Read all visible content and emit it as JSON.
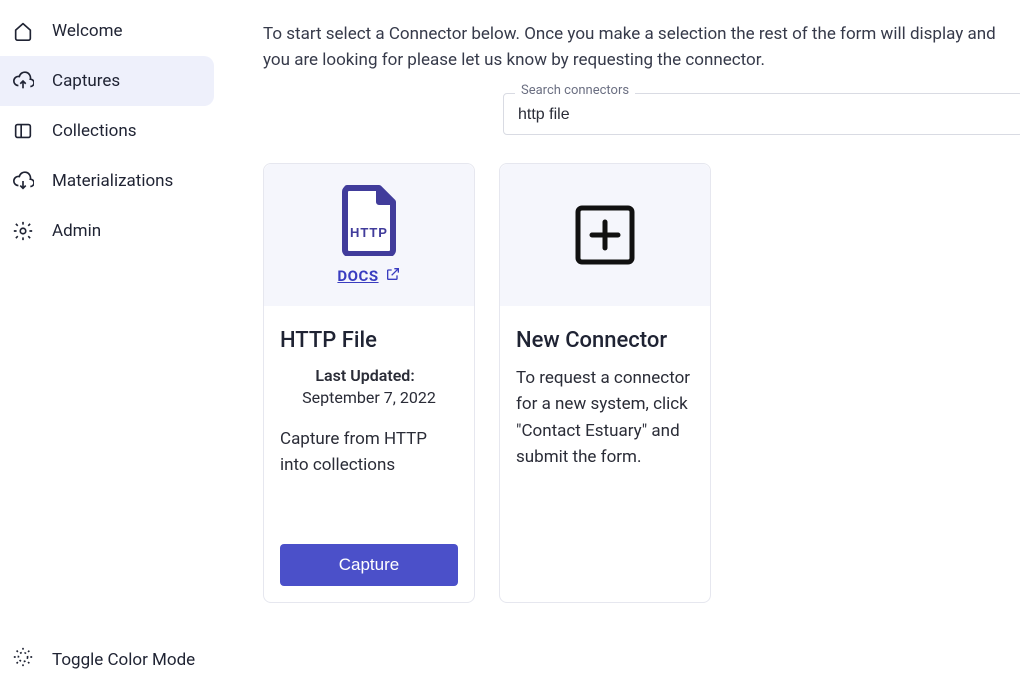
{
  "sidebar": {
    "items": [
      {
        "label": "Welcome"
      },
      {
        "label": "Captures"
      },
      {
        "label": "Collections"
      },
      {
        "label": "Materializations"
      },
      {
        "label": "Admin"
      }
    ],
    "toggle_color_mode": "Toggle Color Mode"
  },
  "intro": "To start select a Connector below. Once you make a selection the rest of the form will display and you are looking for please let us know by requesting the connector.",
  "search": {
    "label": "Search connectors",
    "value": "http file"
  },
  "connector_card": {
    "docs_label": "DOCS",
    "title": "HTTP File",
    "last_updated_label": "Last Updated:",
    "last_updated_value": "September 7, 2022",
    "description": "Capture from HTTP into collections",
    "button": "Capture",
    "icon_text": "HTTP"
  },
  "new_connector_card": {
    "title": "New Connector",
    "description": "To request a connector for a new system, click \"Contact Estuary\" and submit the form."
  }
}
